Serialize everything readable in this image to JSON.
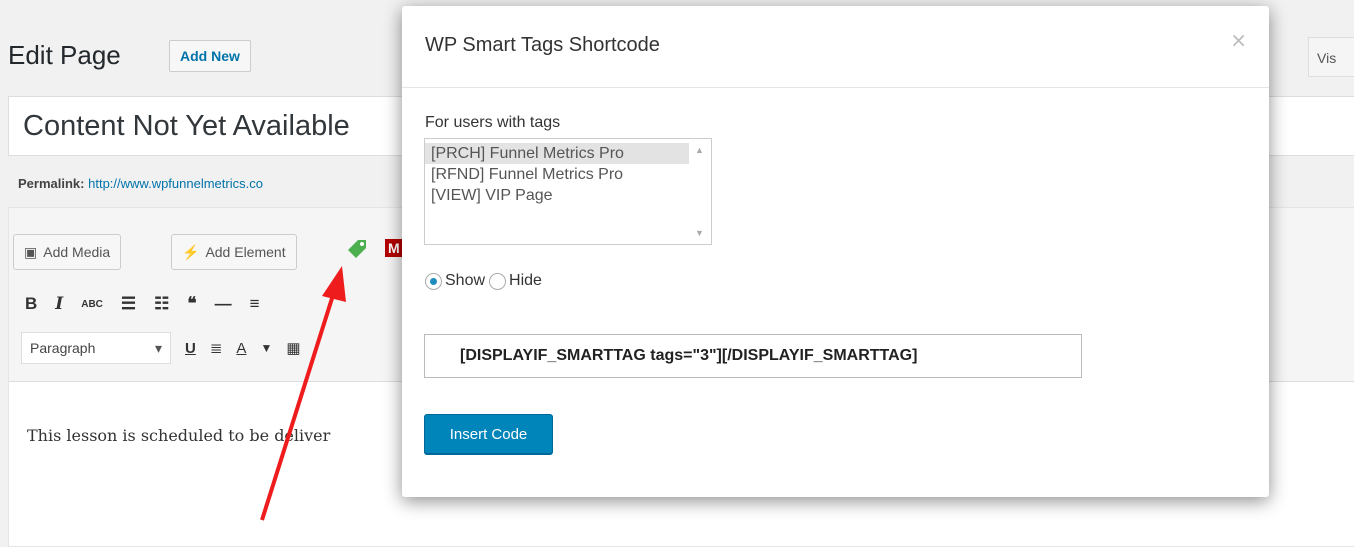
{
  "background": {
    "page_title": "Edit Page",
    "add_new_label": "Add New",
    "post_title": "Content Not Yet Available",
    "permalink_label": "Permalink:",
    "permalink_url": "http://www.wpfunnelmetrics.co",
    "add_media_label": "Add Media",
    "add_element_label": "Add Element",
    "m_badge": "M",
    "visual_tab": "Vis",
    "format_select": "Paragraph",
    "content_text": "This lesson is scheduled to be deliver"
  },
  "modal": {
    "title": "WP Smart Tags Shortcode",
    "close_symbol": "×",
    "users_label": "For users with tags",
    "tag_options": [
      "[PRCH] Funnel Metrics Pro",
      "[RFND] Funnel Metrics Pro",
      "[VIEW] VIP Page"
    ],
    "selected_option": "[PRCH] Funnel Metrics Pro",
    "show_label": "Show",
    "hide_label": "Hide",
    "visibility": "Show",
    "shortcode": "[DISPLAYIF_SMARTTAG tags=\"3\"][/DISPLAYIF_SMARTTAG]",
    "insert_label": "Insert Code"
  },
  "colors": {
    "primary_button": "#0085ba",
    "annotation_arrow": "#ee1c1c"
  }
}
